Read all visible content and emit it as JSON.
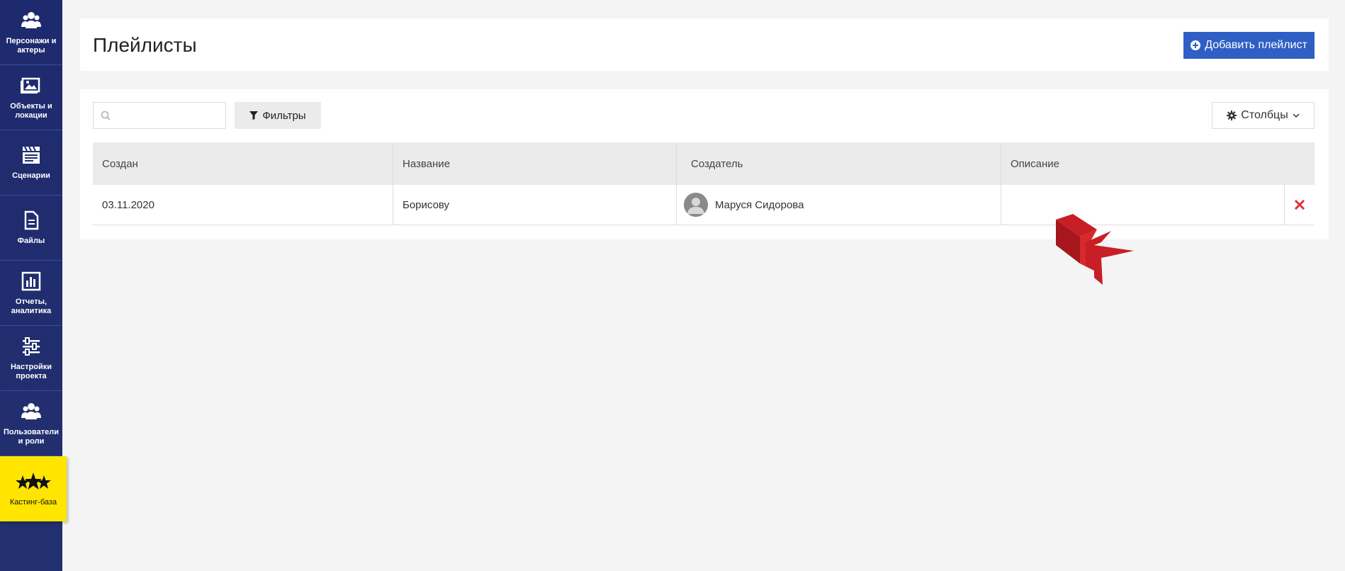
{
  "sidebar": {
    "items": [
      {
        "label": "Персонажи и актеры",
        "icon": "users-icon"
      },
      {
        "label": "Объекты и локации",
        "icon": "image-icon"
      },
      {
        "label": "Сценарии",
        "icon": "clapperboard-icon"
      },
      {
        "label": "Файлы",
        "icon": "file-icon"
      },
      {
        "label": "Отчеты, аналитика",
        "icon": "chart-icon"
      },
      {
        "label": "Настройки проекта",
        "icon": "sliders-icon"
      },
      {
        "label": "Пользователи и роли",
        "icon": "users-icon"
      },
      {
        "label": "Кастинг-база",
        "icon": "stars-icon"
      }
    ]
  },
  "header": {
    "title": "Плейлисты",
    "add_label": "Добавить плейлист"
  },
  "toolbar": {
    "search_value": "",
    "filters_label": "Фильтры",
    "columns_label": "Столбцы"
  },
  "table": {
    "columns": [
      "Создан",
      "Название",
      "Создатель",
      "Описание"
    ],
    "rows": [
      {
        "created": "03.11.2020",
        "name": "Борисову",
        "creator": "Маруся Сидорова",
        "description": ""
      }
    ]
  },
  "colors": {
    "sidebar_bg": "#1e2a6e",
    "accent": "#2f5fc4",
    "casting_bg": "#ffe500",
    "delete": "#d9343a"
  }
}
